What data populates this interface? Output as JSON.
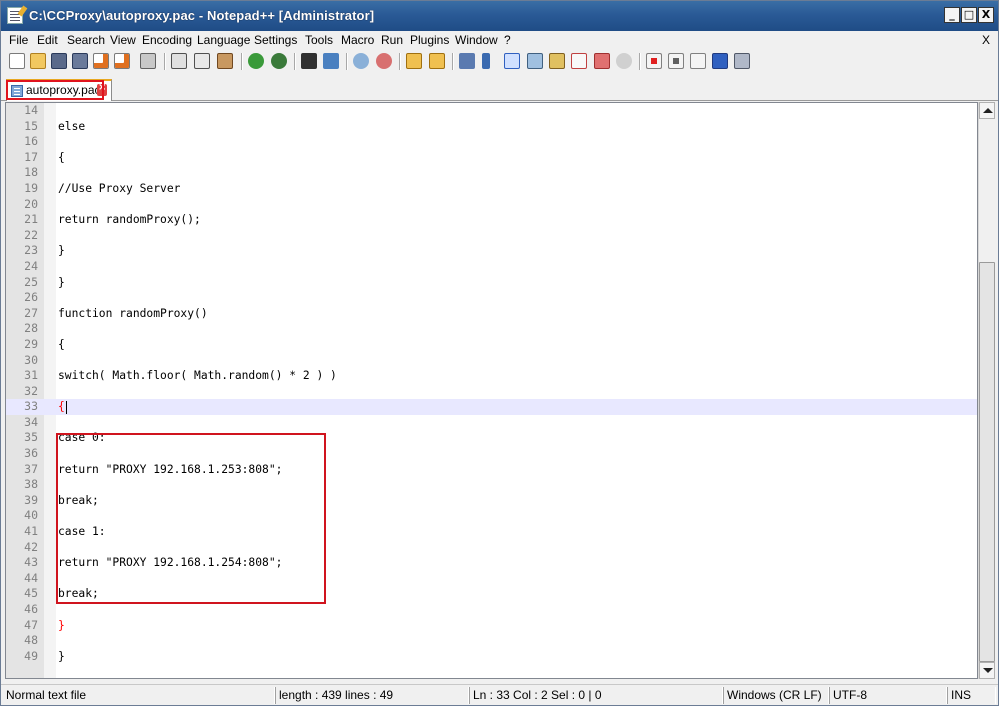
{
  "window": {
    "title": "C:\\CCProxy\\autoproxy.pac - Notepad++ [Administrator]",
    "minimize_glyph": "_",
    "maximize_glyph": "□",
    "close_glyph": "X"
  },
  "menu": {
    "items": [
      "File",
      "Edit",
      "Search",
      "View",
      "Encoding",
      "Language",
      "Settings",
      "Tools",
      "Macro",
      "Run",
      "Plugins",
      "Window",
      "?"
    ],
    "close_label": "X"
  },
  "toolbar": {
    "icons": [
      "new-file-icon",
      "open-file-icon",
      "save-icon",
      "save-all-icon",
      "close-icon",
      "close-all-icon",
      "print-icon",
      "cut-icon",
      "copy-icon",
      "paste-icon",
      "undo-icon",
      "redo-icon",
      "find-icon",
      "replace-icon",
      "zoom-in-icon",
      "zoom-out-icon",
      "sync-vertical-icon",
      "sync-horizontal-icon",
      "word-wrap-icon",
      "show-all-chars-icon",
      "indent-guide-icon",
      "user-lang-icon",
      "doc-map-icon",
      "function-list-icon",
      "folder-workspace-icon",
      "monitoring-icon",
      "record-macro-icon",
      "stop-record-icon",
      "play-macro-icon",
      "run-macro-multiple-icon",
      "save-macro-icon"
    ]
  },
  "tabs": [
    {
      "label": "autoproxy.pac",
      "active": true
    }
  ],
  "editor": {
    "current_line": 33,
    "lines": [
      {
        "n": "14",
        "text": ""
      },
      {
        "n": "15",
        "text": "else"
      },
      {
        "n": "16",
        "text": ""
      },
      {
        "n": "17",
        "text": "{"
      },
      {
        "n": "18",
        "text": ""
      },
      {
        "n": "19",
        "text": "//Use Proxy Server"
      },
      {
        "n": "20",
        "text": ""
      },
      {
        "n": "21",
        "text": "return randomProxy();"
      },
      {
        "n": "22",
        "text": ""
      },
      {
        "n": "23",
        "text": "}"
      },
      {
        "n": "24",
        "text": ""
      },
      {
        "n": "25",
        "text": "}"
      },
      {
        "n": "26",
        "text": ""
      },
      {
        "n": "27",
        "text": "function randomProxy()"
      },
      {
        "n": "28",
        "text": ""
      },
      {
        "n": "29",
        "text": "{"
      },
      {
        "n": "30",
        "text": ""
      },
      {
        "n": "31",
        "text": "switch( Math.floor( Math.random() * 2 ) )"
      },
      {
        "n": "32",
        "text": ""
      },
      {
        "n": "33",
        "text": "{"
      },
      {
        "n": "34",
        "text": ""
      },
      {
        "n": "35",
        "text": "case 0:"
      },
      {
        "n": "36",
        "text": ""
      },
      {
        "n": "37",
        "text": "return \"PROXY 192.168.1.253:808\";"
      },
      {
        "n": "38",
        "text": ""
      },
      {
        "n": "39",
        "text": "break;"
      },
      {
        "n": "40",
        "text": ""
      },
      {
        "n": "41",
        "text": "case 1:"
      },
      {
        "n": "42",
        "text": ""
      },
      {
        "n": "43",
        "text": "return \"PROXY 192.168.1.254:808\";"
      },
      {
        "n": "44",
        "text": ""
      },
      {
        "n": "45",
        "text": "break;"
      },
      {
        "n": "46",
        "text": ""
      },
      {
        "n": "47",
        "text": "}"
      },
      {
        "n": "48",
        "text": ""
      },
      {
        "n": "49",
        "text": "}"
      }
    ],
    "brace_match_lines": [
      "33",
      "47"
    ]
  },
  "statusbar": {
    "file_type": "Normal text file",
    "length_lines": "length : 439    lines : 49",
    "position": "Ln : 33    Col : 2    Sel : 0 | 0",
    "eol": "Windows (CR LF)",
    "encoding": "UTF-8",
    "mode": "INS"
  },
  "colors": {
    "highlight_box": "#d0141e",
    "current_line": "#e8e8ff",
    "brace_match": "#ff0000"
  }
}
